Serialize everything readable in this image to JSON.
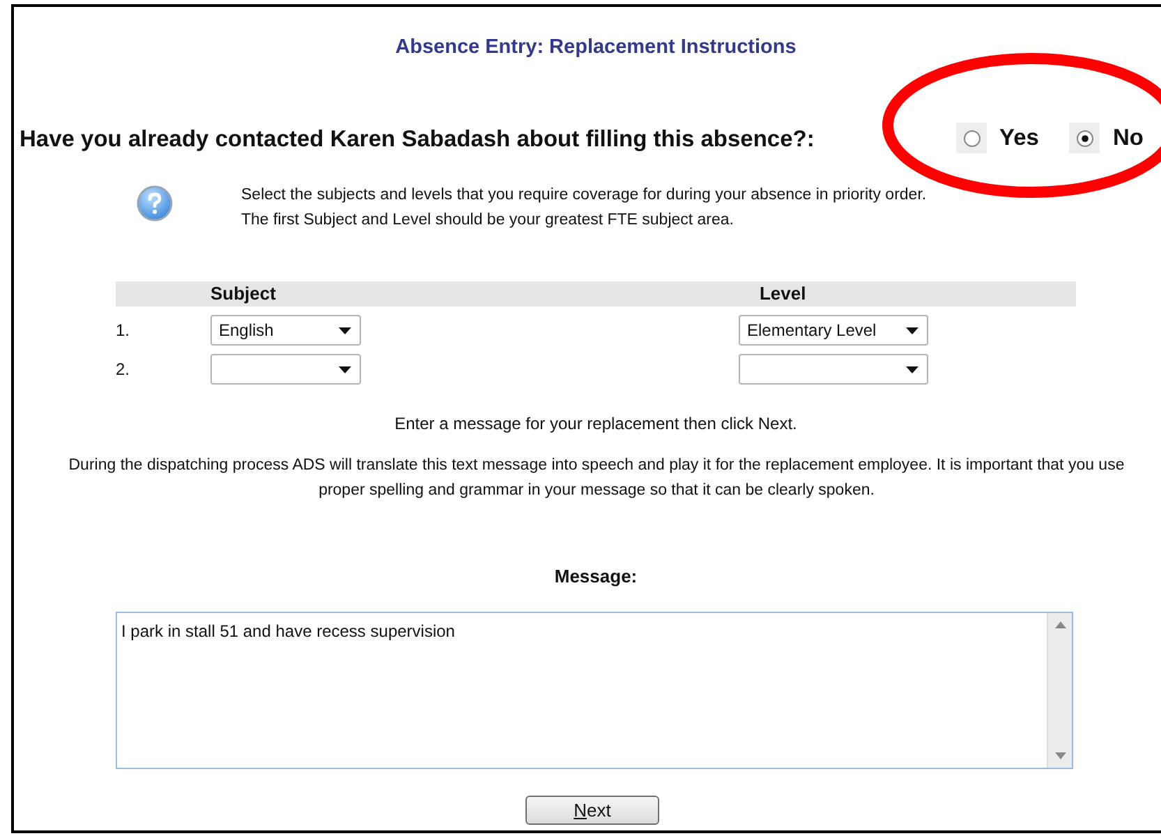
{
  "title": "Absence Entry: Replacement Instructions",
  "question": {
    "text": "Have you already contacted Karen Sabadash about filling this absence?:",
    "options": [
      {
        "label": "Yes",
        "selected": false
      },
      {
        "label": "No",
        "selected": true
      }
    ]
  },
  "annotation": {
    "kind": "ellipse",
    "color": "#ff0000"
  },
  "instructions": "Select the subjects and levels that you require coverage for during your absence in priority order. The first Subject and Level should be your greatest FTE subject area.",
  "table": {
    "columns": [
      "Subject",
      "Level"
    ],
    "rows": [
      {
        "number": "1.",
        "subject": "English",
        "level": "Elementary Level"
      },
      {
        "number": "2.",
        "subject": "",
        "level": ""
      }
    ]
  },
  "prompt": "Enter a message for your replacement then click Next.",
  "note": "During the dispatching process ADS will translate this text message into speech and play it for the replacement employee. It is important that you use proper spelling and grammar in your message so that it can be clearly spoken.",
  "message": {
    "label": "Message:",
    "value": "I park in stall 51 and have recess supervision"
  },
  "button": "Next"
}
